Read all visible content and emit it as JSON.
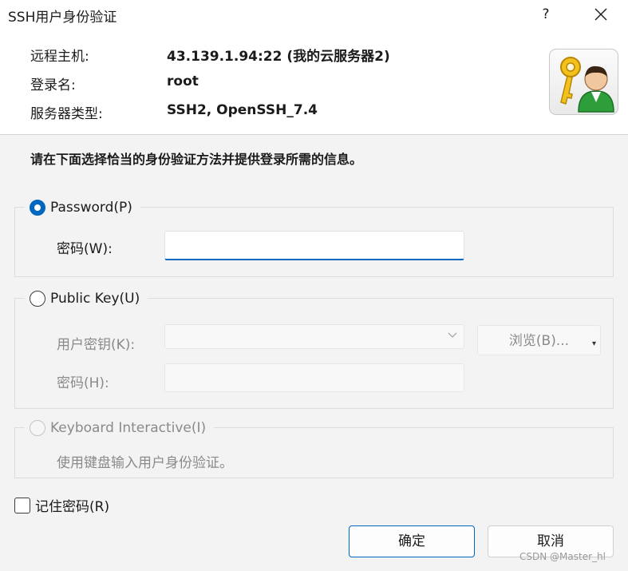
{
  "window": {
    "title": "SSH用户身份验证",
    "help_label": "?",
    "close_label": "×"
  },
  "info": {
    "host_label": "远程主机:",
    "host_value": "43.139.1.94:22 (我的云服务器2)",
    "login_label": "登录名:",
    "login_value": "root",
    "server_type_label": "服务器类型:",
    "server_type_value": "SSH2, OpenSSH_7.4",
    "icon": "key-user-icon"
  },
  "instruction": "请在下面选择恰当的身份验证方法并提供登录所需的信息。",
  "auth_methods": {
    "password": {
      "label": "Password(P)",
      "selected": true,
      "password_field_label": "密码(W):",
      "password_value": ""
    },
    "public_key": {
      "label": "Public Key(U)",
      "selected": false,
      "user_key_label": "用户密钥(K):",
      "user_key_value": "",
      "browse_label": "浏览(B)...",
      "passphrase_label": "密码(H):",
      "passphrase_value": ""
    },
    "keyboard_interactive": {
      "label": "Keyboard Interactive(I)",
      "selected": false,
      "description": "使用键盘输入用户身份验证。"
    }
  },
  "remember_password": {
    "label": "记住密码(R)",
    "checked": false
  },
  "buttons": {
    "ok": "确定",
    "cancel": "取消"
  },
  "watermark": "CSDN @Master_hl",
  "colors": {
    "accent": "#0067c0",
    "background": "#f3f3f3",
    "panel": "#ffffff"
  }
}
